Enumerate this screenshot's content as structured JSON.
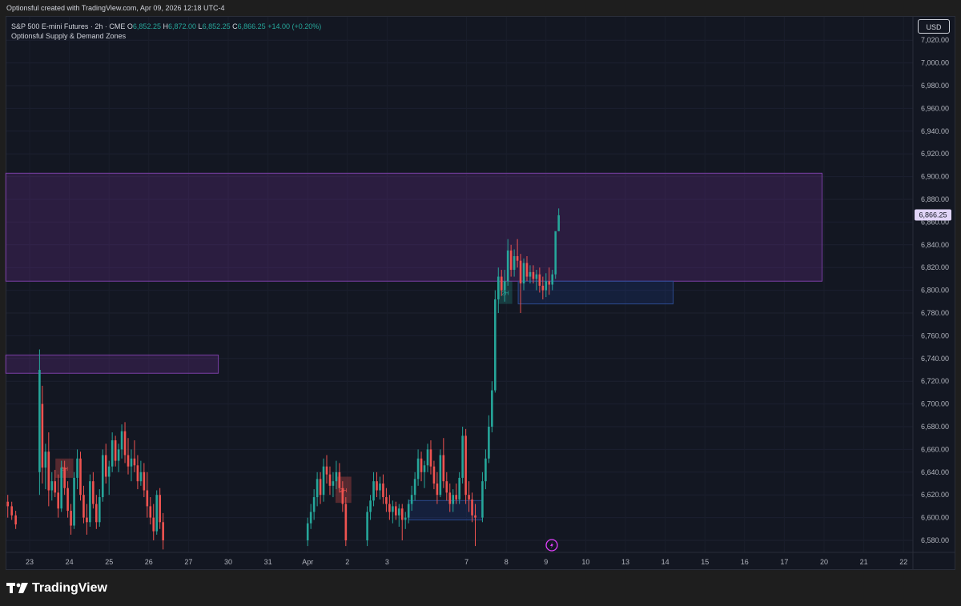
{
  "header": {
    "caption": "Optionsful created with TradingView.com, Apr 09, 2026 12:18 UTC-4"
  },
  "legend": {
    "symbol": "S&P 500 E-mini Futures · 2h · CME",
    "open_label": "O",
    "open": "6,852.25",
    "high_label": "H",
    "high": "6,872.00",
    "low_label": "L",
    "low": "6,852.25",
    "close_label": "C",
    "close": "6,866.25",
    "change": "+14.00 (+0.20%)",
    "indicator": "Optionsful Supply & Demand Zones"
  },
  "currency_button": "USD",
  "branding": {
    "logo_text": "TradingView",
    "logo_icon": "tradingview-logo-icon"
  },
  "colors": {
    "background": "#131722",
    "up": "#26a69a",
    "down": "#ef5350",
    "supply_zone": "#6a2f8f",
    "demand_zone": "#2962ff",
    "last_price_bg": "#e1d5f7"
  },
  "chart_data": {
    "type": "candlestick",
    "symbol": "S&P 500 E-mini Futures",
    "timeframe": "2h",
    "exchange": "CME",
    "y_axis": {
      "ticks": [
        "7,020.00",
        "7,000.00",
        "6,980.00",
        "6,960.00",
        "6,940.00",
        "6,920.00",
        "6,900.00",
        "6,880.00",
        "6,860.00",
        "6,840.00",
        "6,820.00",
        "6,800.00",
        "6,780.00",
        "6,760.00",
        "6,740.00",
        "6,720.00",
        "6,700.00",
        "6,680.00",
        "6,660.00",
        "6,640.00",
        "6,620.00",
        "6,600.00",
        "6,580.00"
      ],
      "ylim": [
        6572,
        7034
      ]
    },
    "x_axis": {
      "ticks": [
        {
          "label": "23",
          "day": 0
        },
        {
          "label": "24",
          "day": 1
        },
        {
          "label": "25",
          "day": 2
        },
        {
          "label": "26",
          "day": 3
        },
        {
          "label": "27",
          "day": 4
        },
        {
          "label": "30",
          "day": 5
        },
        {
          "label": "31",
          "day": 6
        },
        {
          "label": "Apr",
          "day": 7
        },
        {
          "label": "2",
          "day": 8
        },
        {
          "label": "3",
          "day": 9
        },
        {
          "label": "7",
          "day": 11
        },
        {
          "label": "8",
          "day": 12
        },
        {
          "label": "9",
          "day": 13
        },
        {
          "label": "10",
          "day": 14
        },
        {
          "label": "13",
          "day": 15
        },
        {
          "label": "14",
          "day": 16
        },
        {
          "label": "15",
          "day": 17
        },
        {
          "label": "16",
          "day": 18
        },
        {
          "label": "17",
          "day": 19
        },
        {
          "label": "20",
          "day": 20
        },
        {
          "label": "21",
          "day": 21
        },
        {
          "label": "22",
          "day": 22
        }
      ]
    },
    "last_price": "6,866.25",
    "zones": [
      {
        "kind": "supply",
        "x0": -0.6,
        "x1": 19.95,
        "y0": 6808,
        "y1": 6903,
        "label": ""
      },
      {
        "kind": "supply",
        "x0": -0.6,
        "x1": 4.75,
        "y0": 6727,
        "y1": 6743,
        "label": ""
      },
      {
        "kind": "demand",
        "x0": 12.3,
        "x1": 16.2,
        "y0": 6788,
        "y1": 6808,
        "label": ""
      },
      {
        "kind": "demand",
        "x0": 9.55,
        "x1": 11.4,
        "y0": 6598,
        "y1": 6615,
        "label": ""
      },
      {
        "kind": "demand-box",
        "x0": 11.8,
        "x1": 12.15,
        "y0": 6788,
        "y1": 6808,
        "label": "2H"
      },
      {
        "kind": "supply-box",
        "x0": 0.65,
        "x1": 1.1,
        "y0": 6635,
        "y1": 6652,
        "label": "2H"
      },
      {
        "kind": "supply-box",
        "x0": 7.7,
        "x1": 8.1,
        "y0": 6613,
        "y1": 6636,
        "label": "2H"
      }
    ],
    "candles": [
      [
        -0.55,
        6614,
        6620,
        6600,
        6610
      ],
      [
        -0.45,
        6610,
        6614,
        6598,
        6602
      ],
      [
        -0.35,
        6602,
        6606,
        6590,
        6594
      ],
      [
        0.25,
        6640,
        6748,
        6620,
        6730
      ],
      [
        0.32,
        6700,
        6716,
        6630,
        6644
      ],
      [
        0.4,
        6644,
        6665,
        6625,
        6658
      ],
      [
        0.48,
        6658,
        6675,
        6610,
        6624
      ],
      [
        0.56,
        6624,
        6640,
        6615,
        6632
      ],
      [
        0.64,
        6632,
        6642,
        6618,
        6622
      ],
      [
        0.72,
        6622,
        6638,
        6600,
        6608
      ],
      [
        0.8,
        6608,
        6650,
        6605,
        6644
      ],
      [
        0.88,
        6644,
        6650,
        6620,
        6626
      ],
      [
        0.96,
        6626,
        6632,
        6600,
        6606
      ],
      [
        1.04,
        6606,
        6612,
        6585,
        6593
      ],
      [
        1.12,
        6593,
        6640,
        6590,
        6635
      ],
      [
        1.2,
        6635,
        6660,
        6625,
        6652
      ],
      [
        1.28,
        6652,
        6658,
        6615,
        6620
      ],
      [
        1.36,
        6620,
        6628,
        6595,
        6600
      ],
      [
        1.44,
        6600,
        6612,
        6585,
        6596
      ],
      [
        1.52,
        6596,
        6638,
        6592,
        6632
      ],
      [
        1.6,
        6632,
        6640,
        6608,
        6612
      ],
      [
        1.68,
        6612,
        6620,
        6590,
        6596
      ],
      [
        1.76,
        6596,
        6625,
        6592,
        6618
      ],
      [
        1.84,
        6618,
        6660,
        6614,
        6655
      ],
      [
        1.92,
        6655,
        6665,
        6630,
        6636
      ],
      [
        2.0,
        6636,
        6650,
        6620,
        6645
      ],
      [
        2.08,
        6645,
        6675,
        6640,
        6668
      ],
      [
        2.16,
        6668,
        6672,
        6645,
        6650
      ],
      [
        2.24,
        6650,
        6665,
        6640,
        6660
      ],
      [
        2.32,
        6660,
        6682,
        6652,
        6676
      ],
      [
        2.4,
        6676,
        6684,
        6648,
        6655
      ],
      [
        2.48,
        6655,
        6670,
        6638,
        6645
      ],
      [
        2.56,
        6645,
        6660,
        6632,
        6652
      ],
      [
        2.64,
        6652,
        6668,
        6640,
        6646
      ],
      [
        2.72,
        6646,
        6655,
        6625,
        6632
      ],
      [
        2.8,
        6632,
        6650,
        6628,
        6640
      ],
      [
        2.88,
        6640,
        6648,
        6618,
        6624
      ],
      [
        2.96,
        6624,
        6640,
        6600,
        6610
      ],
      [
        3.04,
        6610,
        6618,
        6594,
        6600
      ],
      [
        3.12,
        6600,
        6612,
        6580,
        6588
      ],
      [
        3.2,
        6588,
        6624,
        6585,
        6620
      ],
      [
        3.28,
        6620,
        6626,
        6590,
        6596
      ],
      [
        3.36,
        6596,
        6604,
        6572,
        6580
      ],
      [
        7.0,
        6580,
        6600,
        6575,
        6595
      ],
      [
        7.08,
        6595,
        6612,
        6590,
        6605
      ],
      [
        7.16,
        6605,
        6625,
        6598,
        6618
      ],
      [
        7.24,
        6618,
        6640,
        6610,
        6634
      ],
      [
        7.32,
        6634,
        6640,
        6612,
        6620
      ],
      [
        7.4,
        6620,
        6652,
        6614,
        6645
      ],
      [
        7.48,
        6645,
        6655,
        6630,
        6638
      ],
      [
        7.56,
        6638,
        6645,
        6620,
        6628
      ],
      [
        7.64,
        6628,
        6640,
        6618,
        6632
      ],
      [
        7.72,
        6632,
        6650,
        6625,
        6640
      ],
      [
        7.8,
        6640,
        6648,
        6622,
        6626
      ],
      [
        7.88,
        6626,
        6632,
        6605,
        6612
      ],
      [
        7.96,
        6612,
        6618,
        6575,
        6580
      ],
      [
        8.5,
        6580,
        6610,
        6575,
        6605
      ],
      [
        8.58,
        6605,
        6620,
        6598,
        6615
      ],
      [
        8.66,
        6615,
        6640,
        6610,
        6632
      ],
      [
        8.74,
        6632,
        6640,
        6618,
        6624
      ],
      [
        8.82,
        6624,
        6636,
        6616,
        6630
      ],
      [
        8.9,
        6630,
        6638,
        6612,
        6618
      ],
      [
        8.98,
        6618,
        6626,
        6605,
        6612
      ],
      [
        9.06,
        6612,
        6620,
        6598,
        6605
      ],
      [
        9.14,
        6605,
        6615,
        6595,
        6610
      ],
      [
        9.22,
        6610,
        6614,
        6598,
        6602
      ],
      [
        9.3,
        6602,
        6612,
        6592,
        6608
      ],
      [
        9.38,
        6608,
        6612,
        6580,
        6598
      ],
      [
        9.46,
        6598,
        6605,
        6590,
        6600
      ],
      [
        9.54,
        6600,
        6616,
        6595,
        6612
      ],
      [
        9.62,
        6612,
        6628,
        6606,
        6620
      ],
      [
        9.7,
        6620,
        6640,
        6615,
        6634
      ],
      [
        9.78,
        6634,
        6660,
        6628,
        6652
      ],
      [
        9.86,
        6652,
        6658,
        6632,
        6640
      ],
      [
        9.94,
        6640,
        6650,
        6626,
        6646
      ],
      [
        10.02,
        6646,
        6665,
        6640,
        6660
      ],
      [
        10.1,
        6660,
        6668,
        6638,
        6645
      ],
      [
        10.18,
        6645,
        6650,
        6625,
        6630
      ],
      [
        10.26,
        6630,
        6640,
        6612,
        6620
      ],
      [
        10.34,
        6620,
        6660,
        6618,
        6655
      ],
      [
        10.42,
        6655,
        6670,
        6626,
        6632
      ],
      [
        10.5,
        6632,
        6640,
        6615,
        6622
      ],
      [
        10.58,
        6622,
        6630,
        6605,
        6612
      ],
      [
        10.66,
        6612,
        6625,
        6605,
        6620
      ],
      [
        10.74,
        6620,
        6630,
        6612,
        6616
      ],
      [
        10.82,
        6616,
        6640,
        6612,
        6635
      ],
      [
        10.9,
        6635,
        6680,
        6630,
        6672
      ],
      [
        10.98,
        6672,
        6678,
        6612,
        6620
      ],
      [
        11.06,
        6620,
        6632,
        6605,
        6616
      ],
      [
        11.14,
        6616,
        6622,
        6596,
        6602
      ],
      [
        11.22,
        6602,
        6612,
        6575,
        6600
      ],
      [
        11.4,
        6600,
        6640,
        6596,
        6632
      ],
      [
        11.48,
        6632,
        6660,
        6625,
        6652
      ],
      [
        11.56,
        6652,
        6690,
        6648,
        6680
      ],
      [
        11.64,
        6680,
        6720,
        6675,
        6712
      ],
      [
        11.72,
        6712,
        6800,
        6710,
        6792
      ],
      [
        11.8,
        6792,
        6820,
        6780,
        6812
      ],
      [
        11.88,
        6812,
        6818,
        6795,
        6800
      ],
      [
        11.96,
        6800,
        6818,
        6790,
        6808
      ],
      [
        12.04,
        6808,
        6845,
        6804,
        6835
      ],
      [
        12.12,
        6835,
        6840,
        6812,
        6818
      ],
      [
        12.2,
        6818,
        6836,
        6812,
        6830
      ],
      [
        12.28,
        6830,
        6845,
        6820,
        6826
      ],
      [
        12.36,
        6826,
        6832,
        6780,
        6806
      ],
      [
        12.44,
        6806,
        6828,
        6800,
        6824
      ],
      [
        12.52,
        6824,
        6830,
        6808,
        6812
      ],
      [
        12.6,
        6812,
        6822,
        6806,
        6816
      ],
      [
        12.68,
        6816,
        6822,
        6806,
        6810
      ],
      [
        12.76,
        6810,
        6818,
        6800,
        6814
      ],
      [
        12.84,
        6814,
        6820,
        6798,
        6804
      ],
      [
        12.92,
        6804,
        6812,
        6792,
        6800
      ],
      [
        13.0,
        6800,
        6815,
        6794,
        6808
      ],
      [
        13.08,
        6808,
        6820,
        6796,
        6805
      ],
      [
        13.16,
        6805,
        6818,
        6800,
        6814
      ],
      [
        13.24,
        6814,
        6850,
        6810,
        6852
      ],
      [
        13.32,
        6852,
        6872,
        6852,
        6866
      ]
    ]
  }
}
